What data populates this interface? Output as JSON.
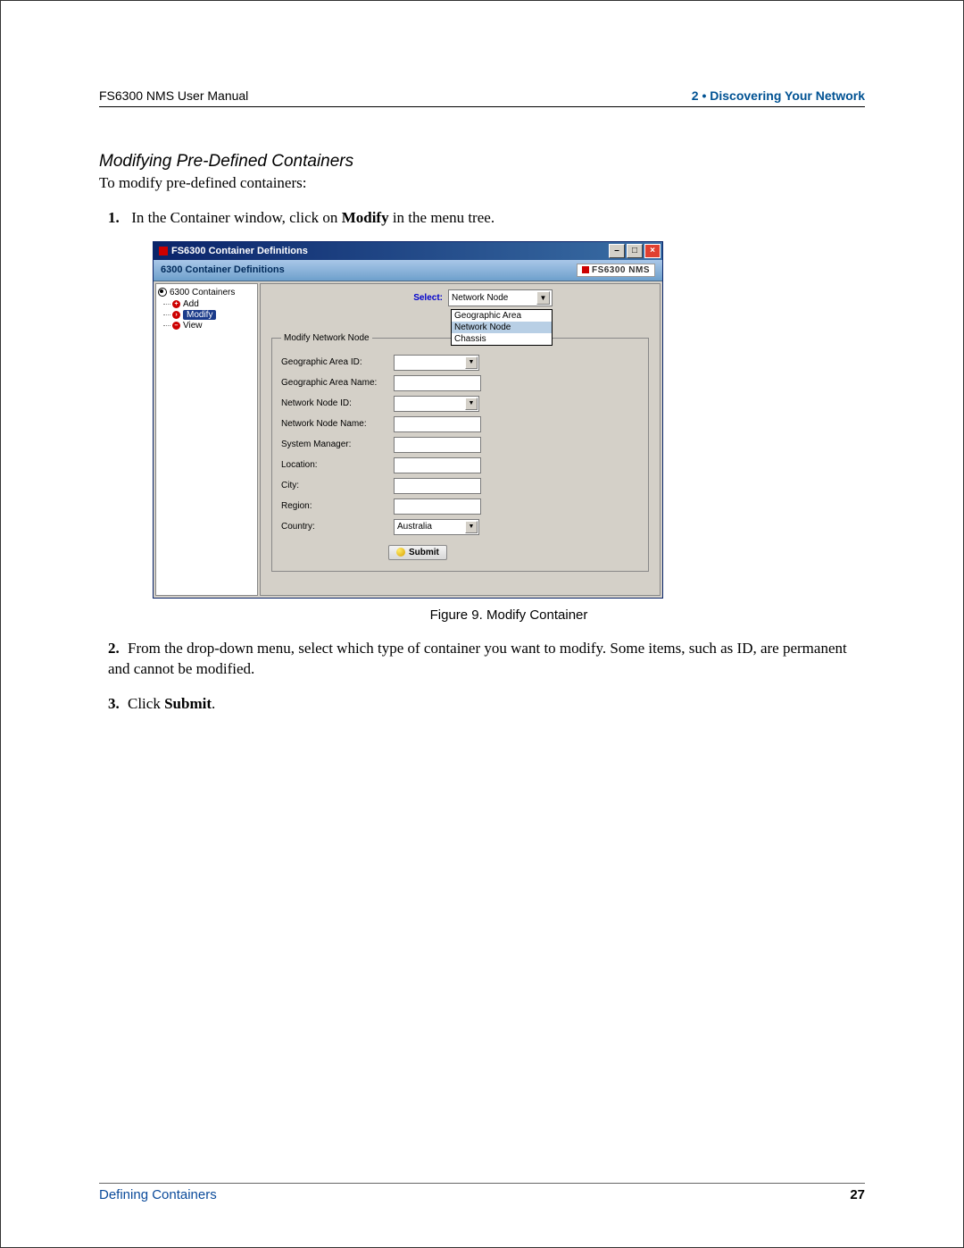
{
  "header": {
    "left": "FS6300 NMS User Manual",
    "right": "2 • Discovering Your Network"
  },
  "section_title": "Modifying Pre-Defined Containers",
  "intro": "To modify pre-defined containers:",
  "steps": {
    "s1_num": "1.",
    "s1_a": "In the Container window, click on ",
    "s1_b": "Modify",
    "s1_c": " in the menu tree.",
    "s2_num": "2.",
    "s2": "From the drop-down menu, select which type of container you want to modify. Some items, such as ID, are permanent and cannot be modified.",
    "s3_num": "3.",
    "s3_a": "Click ",
    "s3_b": "Submit",
    "s3_c": "."
  },
  "figure_caption": "Figure 9. Modify Container",
  "app": {
    "title": "FS6300 Container Definitions",
    "bluebar_left": "6300 Container Definitions",
    "bluebar_right": "FS6300 NMS",
    "tree": {
      "root": "6300 Containers",
      "add": "Add",
      "modify": "Modify",
      "view": "View"
    },
    "select_label": "Select:",
    "select_value": "Network Node",
    "select_options": {
      "o1": "Geographic Area",
      "o2": "Network Node",
      "o3": "Chassis"
    },
    "fieldset_legend": "Modify Network Node",
    "labels": {
      "geo_id": "Geographic Area ID:",
      "geo_name": "Geographic Area Name:",
      "node_id": "Network Node ID:",
      "node_name": "Network Node Name:",
      "sys_mgr": "System Manager:",
      "location": "Location:",
      "city": "City:",
      "region": "Region:",
      "country": "Country:"
    },
    "country_value": "Australia",
    "submit": "Submit"
  },
  "footer": {
    "left": "Defining Containers",
    "right": "27"
  }
}
